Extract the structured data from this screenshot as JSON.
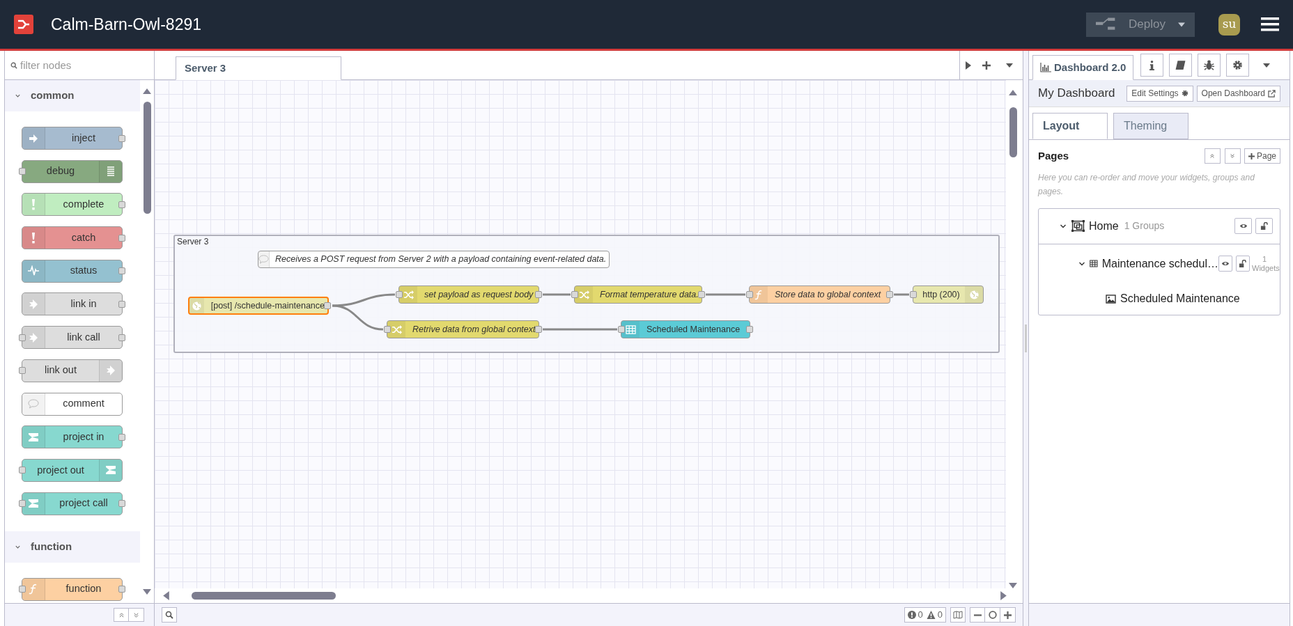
{
  "header": {
    "title": "Calm-Barn-Owl-8291",
    "deploy_label": "Deploy",
    "user_initials": "su"
  },
  "palette": {
    "filter_placeholder": "filter nodes",
    "categories": [
      {
        "name": "common",
        "expanded": true,
        "nodes": [
          {
            "label": "inject",
            "color": "#a6bbcf",
            "kind": "source"
          },
          {
            "label": "debug",
            "color": "#87a980",
            "kind": "sink"
          },
          {
            "label": "complete",
            "color": "#c0edc0",
            "kind": "source"
          },
          {
            "label": "catch",
            "color": "#e49191",
            "kind": "source"
          },
          {
            "label": "status",
            "color": "#94c1d0",
            "kind": "source"
          },
          {
            "label": "link in",
            "color": "#dddddd",
            "kind": "source"
          },
          {
            "label": "link call",
            "color": "#dddddd",
            "kind": "both"
          },
          {
            "label": "link out",
            "color": "#dddddd",
            "kind": "sink"
          },
          {
            "label": "comment",
            "color": "#ffffff",
            "kind": "none"
          },
          {
            "label": "project in",
            "color": "#87d8cf",
            "kind": "source"
          },
          {
            "label": "project out",
            "color": "#87d8cf",
            "kind": "sink"
          },
          {
            "label": "project call",
            "color": "#87d8cf",
            "kind": "both"
          }
        ]
      },
      {
        "name": "function",
        "expanded": true,
        "nodes": [
          {
            "label": "function",
            "color": "#fdd0a2",
            "kind": "both"
          }
        ]
      }
    ]
  },
  "workspace": {
    "tabs": [
      {
        "label": "Server 3",
        "selected": true
      }
    ],
    "group": {
      "label": "Server 3"
    },
    "comment": {
      "text": "Receives a POST request from Server 2 with a payload containing event-related data."
    },
    "nodes": [
      {
        "label": "[post] /schedule-maintenance",
        "color": "#e7e7ae",
        "kind": "source",
        "italic": false,
        "selected": true
      },
      {
        "label": "set payload as request body",
        "color": "#e2d96e",
        "kind": "both",
        "italic": true,
        "selected": false
      },
      {
        "label": "Format temperature data.",
        "color": "#e2d96e",
        "kind": "both",
        "italic": true,
        "selected": false
      },
      {
        "label": "Store data to global context",
        "color": "#fdd0a2",
        "kind": "both",
        "italic": true,
        "selected": false
      },
      {
        "label": "http (200)",
        "color": "#e7e7ae",
        "kind": "sink",
        "italic": false,
        "selected": false
      },
      {
        "label": "Retrive data from global context",
        "color": "#e2d96e",
        "kind": "both",
        "italic": true,
        "selected": false
      },
      {
        "label": "Scheduled Maintenance",
        "color": "#5bcbd6",
        "kind": "both",
        "italic": false,
        "selected": false
      }
    ],
    "status": {
      "errors": "0",
      "warnings": "0"
    }
  },
  "sidebar": {
    "tabs": [
      {
        "label": "Dashboard 2.0",
        "selected": true
      }
    ],
    "dashboard_name": "My Dashboard",
    "edit_button": "Edit Settings",
    "open_button": "Open Dashboard",
    "subtabs": [
      {
        "label": "Layout",
        "selected": true
      },
      {
        "label": "Theming",
        "selected": false
      }
    ],
    "pages_heading": "Pages",
    "add_page_button": "Page",
    "hint": "Here you can re-order and move your widgets, groups and pages.",
    "pages": [
      {
        "label": "Home",
        "meta": "1 Groups",
        "expanded": true,
        "children": [
          {
            "label": "Maintenance schedul…",
            "meta": "1 Widgets",
            "expanded": true,
            "children": [
              {
                "label": "Scheduled Maintenance"
              }
            ]
          }
        ]
      }
    ]
  }
}
